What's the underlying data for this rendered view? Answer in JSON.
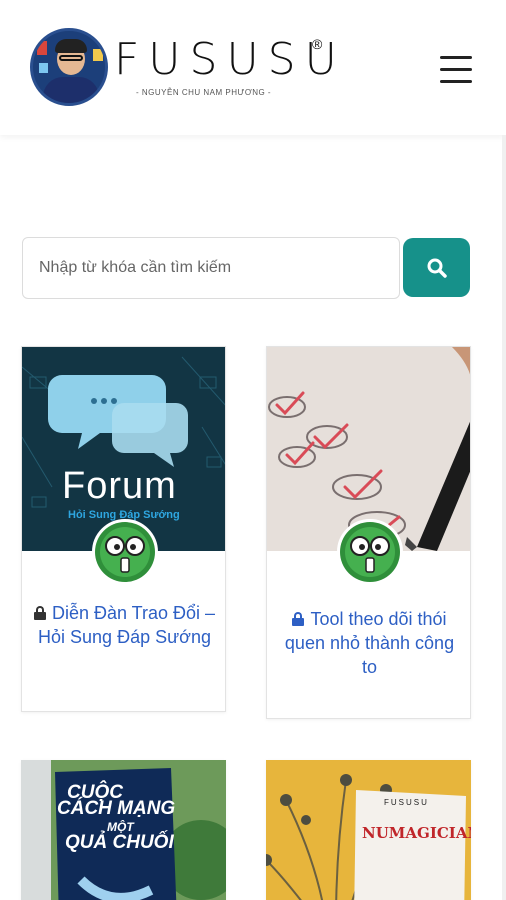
{
  "header": {
    "brand_name": "FUSUSU",
    "brand_mark": "®",
    "brand_subtitle": "- NGUYỄN CHU NAM PHƯƠNG -",
    "menu_icon": "hamburger-menu-icon"
  },
  "search": {
    "placeholder": "Nhập từ khóa cần tìm kiếm",
    "button_icon": "search-icon"
  },
  "colors": {
    "accent": "#16918a",
    "link": "#2d5fc4"
  },
  "cards": [
    {
      "title": "Diễn Đàn Trao Đổi – Hỏi Sung Đáp Sướng",
      "locked": true,
      "image": {
        "word": "Forum",
        "subtitle": "Hỏi Sung Đáp Sướng"
      }
    },
    {
      "title": "Tool theo dõi thói quen nhỏ thành công to",
      "locked": true
    },
    {
      "title": "",
      "image": {
        "line1": "CUỘC",
        "line2": "CÁCH MẠNG",
        "line3": "MỘT",
        "line4": "QUẢ CHUỐI"
      }
    },
    {
      "title": "",
      "image": {
        "top": "FUSUSU",
        "title": "NUMAGICIAN"
      }
    }
  ]
}
